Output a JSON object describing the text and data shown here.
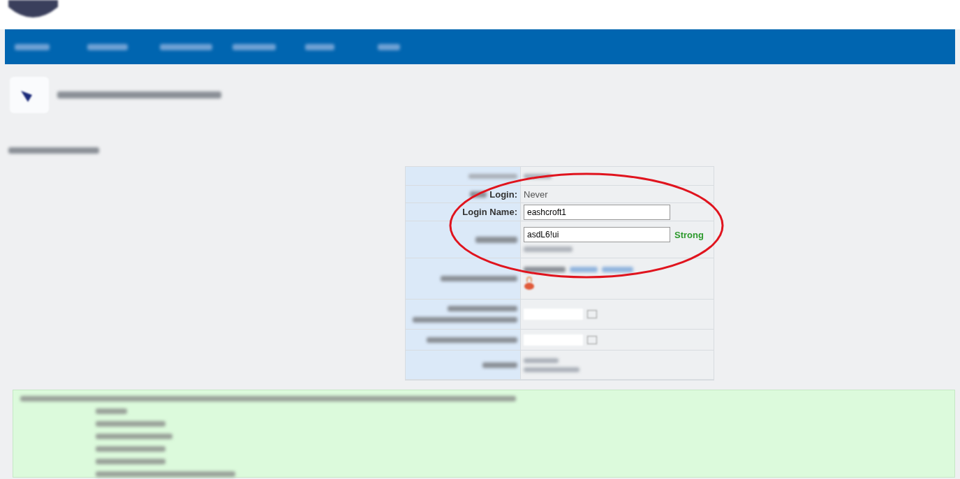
{
  "form": {
    "rows": [
      {
        "kind": "text",
        "label": "Login:",
        "value": "Never"
      },
      {
        "kind": "input",
        "label": "Login Name:",
        "value": "eashcroft1"
      },
      {
        "kind": "password",
        "value": "asdL6!ui",
        "strength": "Strong"
      }
    ]
  }
}
